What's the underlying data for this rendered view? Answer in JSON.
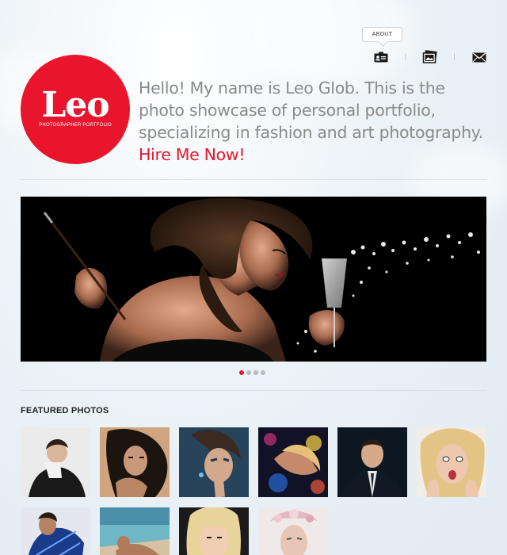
{
  "nav": {
    "tooltip": "ABOUT",
    "items": [
      {
        "icon": "id-card-icon"
      },
      {
        "icon": "photos-icon"
      },
      {
        "icon": "mail-icon"
      }
    ]
  },
  "logo": {
    "title": "Leo",
    "subtitle": "PHOTOGRAPHER PORTFOLIO"
  },
  "intro": {
    "text": "Hello! My name is Leo Glob. This is the photo showcase of personal portfolio, specializing in fashion and art photography.",
    "cta": "Hire Me Now!"
  },
  "slider": {
    "slides_count": 4,
    "active_index": 0
  },
  "featured": {
    "title": "FEATURED PHOTOS",
    "photos_count": 10
  },
  "colors": {
    "accent": "#e8152d",
    "background": "#e6eef4"
  }
}
